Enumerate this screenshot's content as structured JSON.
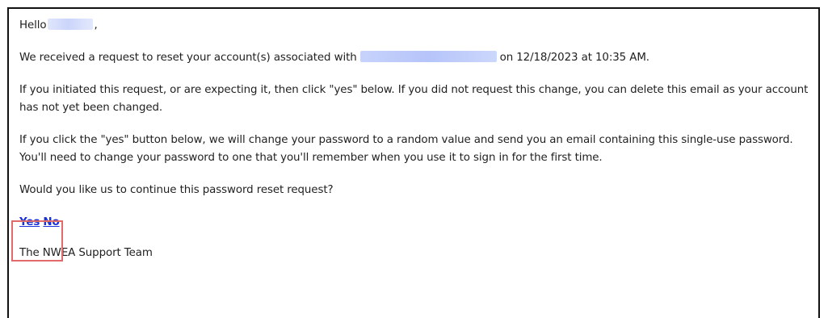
{
  "email": {
    "greeting_prefix": "Hello",
    "greeting_suffix": ",",
    "received_prefix": "We received a request to reset your account(s) associated with",
    "received_suffix": "on 12/18/2023 at 10:35 AM.",
    "initiated_text": "If you initiated this request, or are expecting it, then click \"yes\" below. If you did not request this change, you can delete this email as your account has not yet been changed.",
    "yes_button_text": "If you click the \"yes\" button below, we will change your password to a random value and send you an email containing this single-use password. You'll need to change your password to one that you'll remember when you use it to sign in for the first time.",
    "question": "Would you like us to continue this password reset request?",
    "yes_link": "Yes",
    "no_link": "No",
    "signature": "The NWEA Support Team"
  },
  "colors": {
    "link": "#1a31d8",
    "highlight_border": "#e26a6a",
    "redaction": "#c7d3fb"
  }
}
